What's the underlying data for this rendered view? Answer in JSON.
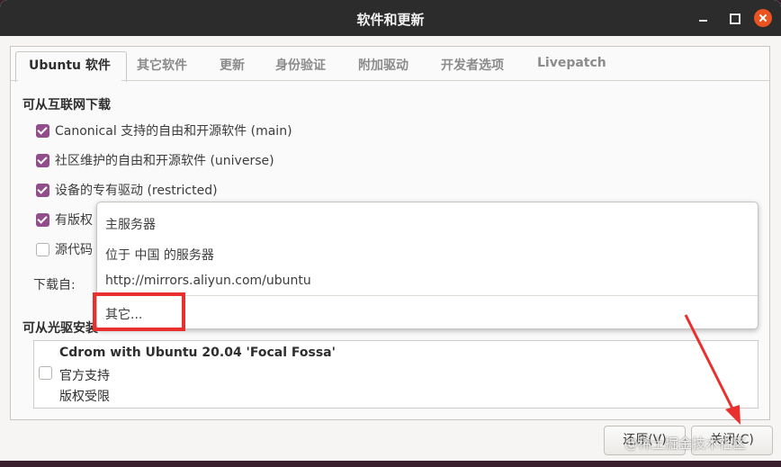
{
  "window": {
    "title": "软件和更新"
  },
  "tabs": [
    "Ubuntu 软件",
    "其它软件",
    "更新",
    "身份验证",
    "附加驱动",
    "开发者选项",
    "Livepatch"
  ],
  "internet_section": {
    "title": "可从互联网下载",
    "items": [
      {
        "label": "Canonical 支持的自由和开源软件 (main)",
        "checked": true
      },
      {
        "label": "社区维护的自由和开源软件 (universe)",
        "checked": true
      },
      {
        "label": "设备的专有驱动 (restricted)",
        "checked": true
      },
      {
        "label": "有版权",
        "checked": true
      },
      {
        "label": "源代码",
        "checked": false
      }
    ],
    "download_from_label": "下载自:"
  },
  "dropdown": {
    "options": [
      "主服务器",
      "位于 中国 的服务器",
      "http://mirrors.aliyun.com/ubuntu",
      "其它..."
    ]
  },
  "cdrom_section": {
    "title": "可从光驱安装",
    "entry": {
      "name": "Cdrom with Ubuntu 20.04 'Focal Fossa'",
      "line2": "官方支持",
      "line3": "版权受限",
      "checked": false
    }
  },
  "buttons": {
    "revert": "还原(V)",
    "close": "关闭(C)"
  },
  "watermark": "@稀土掘金技术社区",
  "colors": {
    "accent_checkbox": "#924d8b",
    "close_button": "#e95420",
    "annotation_red": "#e8312e"
  }
}
